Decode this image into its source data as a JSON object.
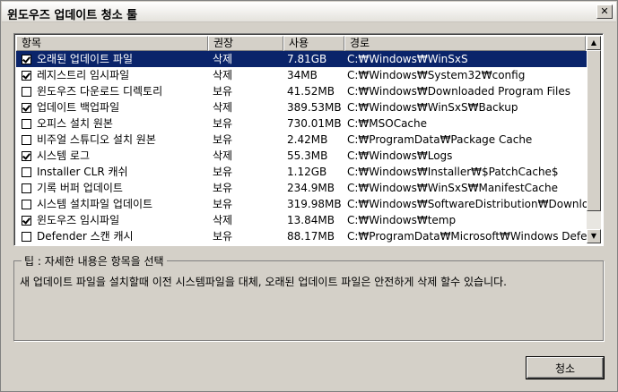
{
  "window": {
    "title": "윈도우즈 업데이트 청소 툴"
  },
  "list": {
    "columns": [
      "항목",
      "권장",
      "사용",
      "경로"
    ],
    "rows": [
      {
        "checked": true,
        "name": "오래된 업데이트 파일",
        "recommend": "삭제",
        "size": "7.81GB",
        "path": "C:₩Windows₩WinSxS",
        "selected": true
      },
      {
        "checked": true,
        "name": "레지스트리 임시파일",
        "recommend": "삭제",
        "size": "34MB",
        "path": "C:₩Windows₩System32₩config"
      },
      {
        "checked": false,
        "name": "윈도우즈 다운로드 디렉토리",
        "recommend": "보유",
        "size": "41.52MB",
        "path": "C:₩Windows₩Downloaded Program Files"
      },
      {
        "checked": true,
        "name": "업데이트 백업파일",
        "recommend": "삭제",
        "size": "389.53MB",
        "path": "C:₩Windows₩WinSxS₩Backup"
      },
      {
        "checked": false,
        "name": "오피스 설치 원본",
        "recommend": "보유",
        "size": "730.01MB",
        "path": "C:₩MSOCache"
      },
      {
        "checked": false,
        "name": "비주얼 스튜디오 설치 원본",
        "recommend": "보유",
        "size": "2.42MB",
        "path": "C:₩ProgramData₩Package Cache"
      },
      {
        "checked": true,
        "name": "시스템 로그",
        "recommend": "삭제",
        "size": "55.3MB",
        "path": "C:₩Windows₩Logs"
      },
      {
        "checked": false,
        "name": "Installer CLR 캐쉬",
        "recommend": "보유",
        "size": "1.12GB",
        "path": "C:₩Windows₩Installer₩$PatchCache$"
      },
      {
        "checked": false,
        "name": "기록 버퍼 업데이트",
        "recommend": "보유",
        "size": "234.9MB",
        "path": "C:₩Windows₩WinSxS₩ManifestCache"
      },
      {
        "checked": false,
        "name": "시스템 설치파일 업데이트",
        "recommend": "보유",
        "size": "319.98MB",
        "path": "C:₩Windows₩SoftwareDistribution₩Download"
      },
      {
        "checked": true,
        "name": "윈도우즈 임시파일",
        "recommend": "삭제",
        "size": "13.84MB",
        "path": "C:₩Windows₩temp"
      },
      {
        "checked": false,
        "name": "Defender 스캔 캐시",
        "recommend": "보유",
        "size": "88.17MB",
        "path": "C:₩ProgramData₩Microsoft₩Windows Defe..."
      }
    ]
  },
  "tip": {
    "label": "팁 : 자세한 내용은 항목을 선택",
    "text": "새 업데이트 파일을 설치할때 이전 시스템파일을 대체, 오래된 업데이트 파일은 안전하게 삭제 할수 있습니다."
  },
  "buttons": {
    "clean": "청소"
  }
}
